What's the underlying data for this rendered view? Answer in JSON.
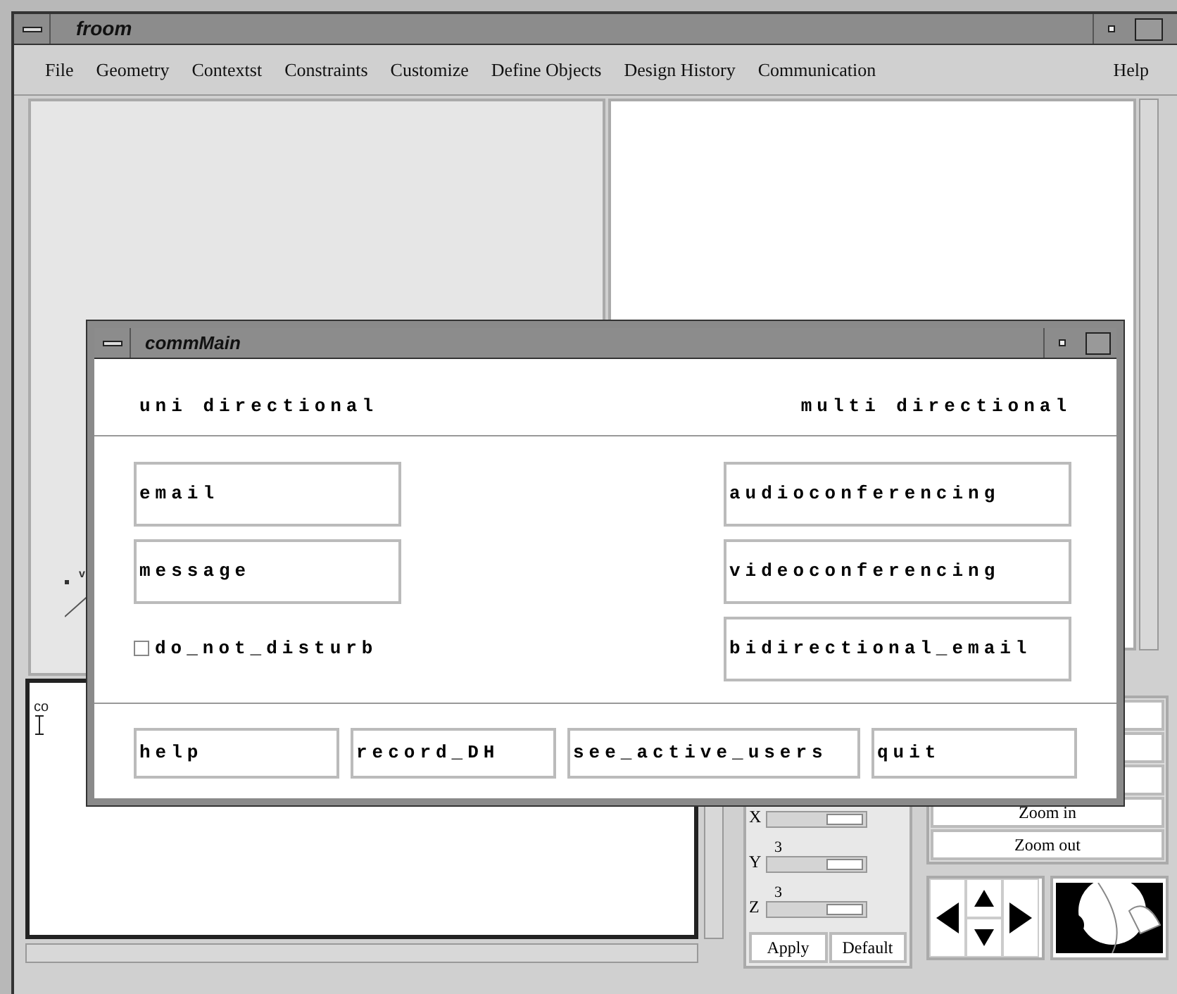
{
  "window": {
    "title": "froom"
  },
  "menu": [
    {
      "label": "File"
    },
    {
      "label": "Geometry"
    },
    {
      "label": "Contextst"
    },
    {
      "label": "Constraints"
    },
    {
      "label": "Customize"
    },
    {
      "label": "Define Objects"
    },
    {
      "label": "Design History"
    },
    {
      "label": "Communication"
    },
    {
      "label": "Help"
    }
  ],
  "canvas": {
    "axis_label": "v"
  },
  "console": {
    "text": "co"
  },
  "view_controls": {
    "sliders": [
      {
        "axis": "X",
        "level": 0.95
      },
      {
        "axis": "Y",
        "value": "3",
        "level": 0.95
      },
      {
        "axis": "Z",
        "value": "3",
        "level": 0.95
      }
    ],
    "buttons": [
      "Apply",
      "Default"
    ]
  },
  "zoom_buttons": [
    "Zoom in",
    "Zoom out"
  ],
  "dialog": {
    "title": "commMain",
    "left_heading": "uni directional",
    "right_heading": "multi directional",
    "left_items": [
      {
        "kind": "button",
        "label": "email"
      },
      {
        "kind": "button",
        "label": "message"
      },
      {
        "kind": "checkbox",
        "label": "do_not_disturb",
        "checked": false
      }
    ],
    "right_items": [
      "audioconferencing",
      "videoconferencing",
      "bidirectional_email"
    ],
    "footer_buttons": [
      "help",
      "record_DH",
      "see_active_users",
      "quit"
    ]
  }
}
